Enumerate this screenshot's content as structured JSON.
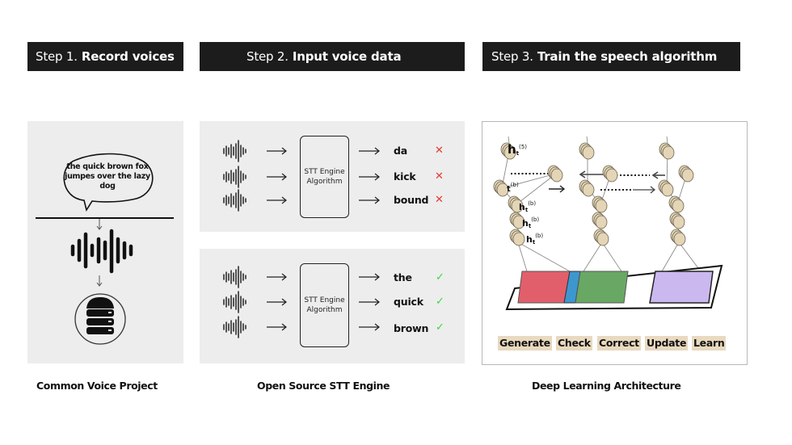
{
  "steps": [
    {
      "prefix": "Step 1.",
      "title": "Record voices"
    },
    {
      "prefix": "Step 2.",
      "title": "Input voice data"
    },
    {
      "prefix": "Step 3.",
      "title": "Train the speech algorithm"
    }
  ],
  "step1": {
    "speech_bubble": "the quick brown fox jumpes over the lazy dog",
    "icons": [
      "speech-bubble-icon",
      "arrow-down-icon",
      "sound-wave-icon",
      "arrow-down-icon",
      "database-server-icon"
    ],
    "caption": "Common Voice Project"
  },
  "step2": {
    "engine_label_line1": "STT Engine",
    "engine_label_line2": "Algorithm",
    "before": {
      "outputs": [
        {
          "word": "da",
          "result": "✕",
          "status": "incorrect"
        },
        {
          "word": "kick",
          "result": "✕",
          "status": "incorrect"
        },
        {
          "word": "bound",
          "result": "✕",
          "status": "incorrect"
        }
      ]
    },
    "after": {
      "outputs": [
        {
          "word": "the",
          "result": "✓",
          "status": "correct"
        },
        {
          "word": "quick",
          "result": "✓",
          "status": "correct"
        },
        {
          "word": "brown",
          "result": "✓",
          "status": "correct"
        }
      ]
    },
    "colors": {
      "incorrect": "#e53935",
      "correct": "#3ad93a"
    },
    "caption": "Open Source STT Engine"
  },
  "step3": {
    "labels": {
      "h_top": "h",
      "h_top_sub": "t",
      "h_top_sup": "(5)",
      "t_mid": "t",
      "t_mid_sup": "(b)",
      "h_b": "h",
      "h_b_sub": "t",
      "h_b_sup": "(b)"
    },
    "blocks": [
      {
        "name": "red-block",
        "color": "#e15f6b"
      },
      {
        "name": "blue-block",
        "color": "#3d97cf"
      },
      {
        "name": "green-block",
        "color": "#69a864"
      },
      {
        "name": "purple-block",
        "color": "#cbb8ef"
      }
    ],
    "node_color": "#e3d5b5",
    "tags": [
      "Generate",
      "Check",
      "Correct",
      "Update",
      "Learn"
    ],
    "tag_color": "#e8d9bf",
    "caption": "Deep Learning Architecture"
  }
}
